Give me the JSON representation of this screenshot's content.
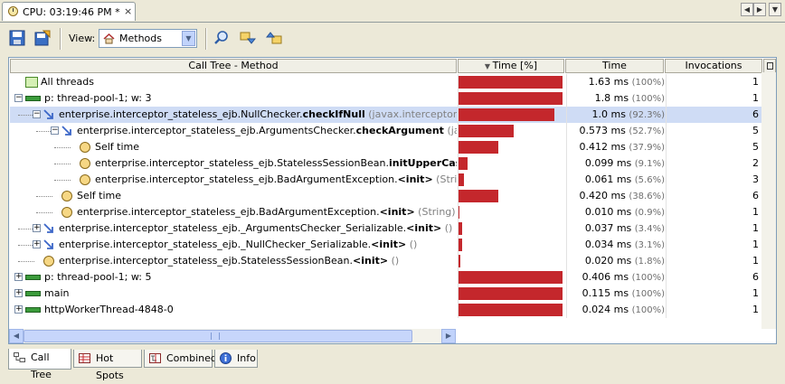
{
  "tab": {
    "title": "CPU: 03:19:46 PM *",
    "close": "×"
  },
  "toolbar": {
    "view_label": "View:",
    "view_value": "Methods"
  },
  "columns": {
    "method": "Call Tree - Method",
    "time_pct": "Time [%]",
    "time": "Time",
    "invocations": "Invocations"
  },
  "rows": [
    {
      "depth": 0,
      "toggle": "",
      "icon": "all",
      "name": "All threads",
      "method": "",
      "args": "",
      "bar": 1.0,
      "time": "1.63 ms",
      "pct": "(100%)",
      "inv": "1"
    },
    {
      "depth": 0,
      "toggle": "−",
      "icon": "thread",
      "name": "p: thread-pool-1; w: 3",
      "method": "",
      "args": "",
      "bar": 1.0,
      "time": "1.8 ms",
      "pct": "(100%)",
      "inv": "1"
    },
    {
      "depth": 1,
      "toggle": "−",
      "icon": "method",
      "name": "enterprise.interceptor_stateless_ejb.NullChecker.",
      "method": "checkIfNull",
      "args": " (javax.interceptor.Invocati",
      "bar": 0.923,
      "time": "1.0 ms",
      "pct": "(92.3%)",
      "inv": "6",
      "selected": true
    },
    {
      "depth": 2,
      "toggle": "−",
      "icon": "method",
      "name": "enterprise.interceptor_stateless_ejb.ArgumentsChecker.",
      "method": "checkArgument",
      "args": " (javax.int",
      "bar": 0.527,
      "time": "0.573 ms",
      "pct": "(52.7%)",
      "inv": "5"
    },
    {
      "depth": 3,
      "toggle": "",
      "icon": "clock",
      "name": "Self time",
      "method": "",
      "args": "",
      "bar": 0.379,
      "time": "0.412 ms",
      "pct": "(37.9%)",
      "inv": "5"
    },
    {
      "depth": 3,
      "toggle": "",
      "icon": "clock",
      "name": "enterprise.interceptor_stateless_ejb.StatelessSessionBean.",
      "method": "initUpperCase",
      "args": " (Strin",
      "bar": 0.091,
      "time": "0.099 ms",
      "pct": "(9.1%)",
      "inv": "2"
    },
    {
      "depth": 3,
      "toggle": "",
      "icon": "clock",
      "name": "enterprise.interceptor_stateless_ejb.BadArgumentException.",
      "method": "<init>",
      "args": " (String)",
      "bar": 0.056,
      "time": "0.061 ms",
      "pct": "(5.6%)",
      "inv": "3"
    },
    {
      "depth": 2,
      "toggle": "",
      "icon": "clock",
      "name": "Self time",
      "method": "",
      "args": "",
      "bar": 0.386,
      "time": "0.420 ms",
      "pct": "(38.6%)",
      "inv": "6"
    },
    {
      "depth": 2,
      "toggle": "",
      "icon": "clock",
      "name": "enterprise.interceptor_stateless_ejb.BadArgumentException.",
      "method": "<init>",
      "args": " (String)",
      "bar": 0.009,
      "time": "0.010 ms",
      "pct": "(0.9%)",
      "inv": "1"
    },
    {
      "depth": 1,
      "toggle": "+",
      "icon": "method",
      "name": "enterprise.interceptor_stateless_ejb._ArgumentsChecker_Serializable.",
      "method": "<init>",
      "args": " ()",
      "bar": 0.034,
      "time": "0.037 ms",
      "pct": "(3.4%)",
      "inv": "1"
    },
    {
      "depth": 1,
      "toggle": "+",
      "icon": "method",
      "name": "enterprise.interceptor_stateless_ejb._NullChecker_Serializable.",
      "method": "<init>",
      "args": " ()",
      "bar": 0.031,
      "time": "0.034 ms",
      "pct": "(3.1%)",
      "inv": "1"
    },
    {
      "depth": 1,
      "toggle": "",
      "icon": "clock",
      "name": "enterprise.interceptor_stateless_ejb.StatelessSessionBean.",
      "method": "<init>",
      "args": " ()",
      "bar": 0.018,
      "time": "0.020 ms",
      "pct": "(1.8%)",
      "inv": "1"
    },
    {
      "depth": 0,
      "toggle": "+",
      "icon": "thread",
      "name": "p: thread-pool-1; w: 5",
      "method": "",
      "args": "",
      "bar": 1.0,
      "time": "0.406 ms",
      "pct": "(100%)",
      "inv": "6"
    },
    {
      "depth": 0,
      "toggle": "+",
      "icon": "thread",
      "name": "main",
      "method": "",
      "args": "",
      "bar": 1.0,
      "time": "0.115 ms",
      "pct": "(100%)",
      "inv": "1"
    },
    {
      "depth": 0,
      "toggle": "+",
      "icon": "thread",
      "name": "httpWorkerThread-4848-0",
      "method": "",
      "args": "",
      "bar": 1.0,
      "time": "0.024 ms",
      "pct": "(100%)",
      "inv": "1"
    }
  ],
  "bottom_tabs": [
    {
      "label": "Call Tree",
      "active": true
    },
    {
      "label": "Hot Spots",
      "active": false
    },
    {
      "label": "Combined",
      "active": false
    },
    {
      "label": "Info",
      "active": false
    }
  ],
  "colors": {
    "bar": "#c4272c",
    "selection": "#cfdcf5"
  }
}
